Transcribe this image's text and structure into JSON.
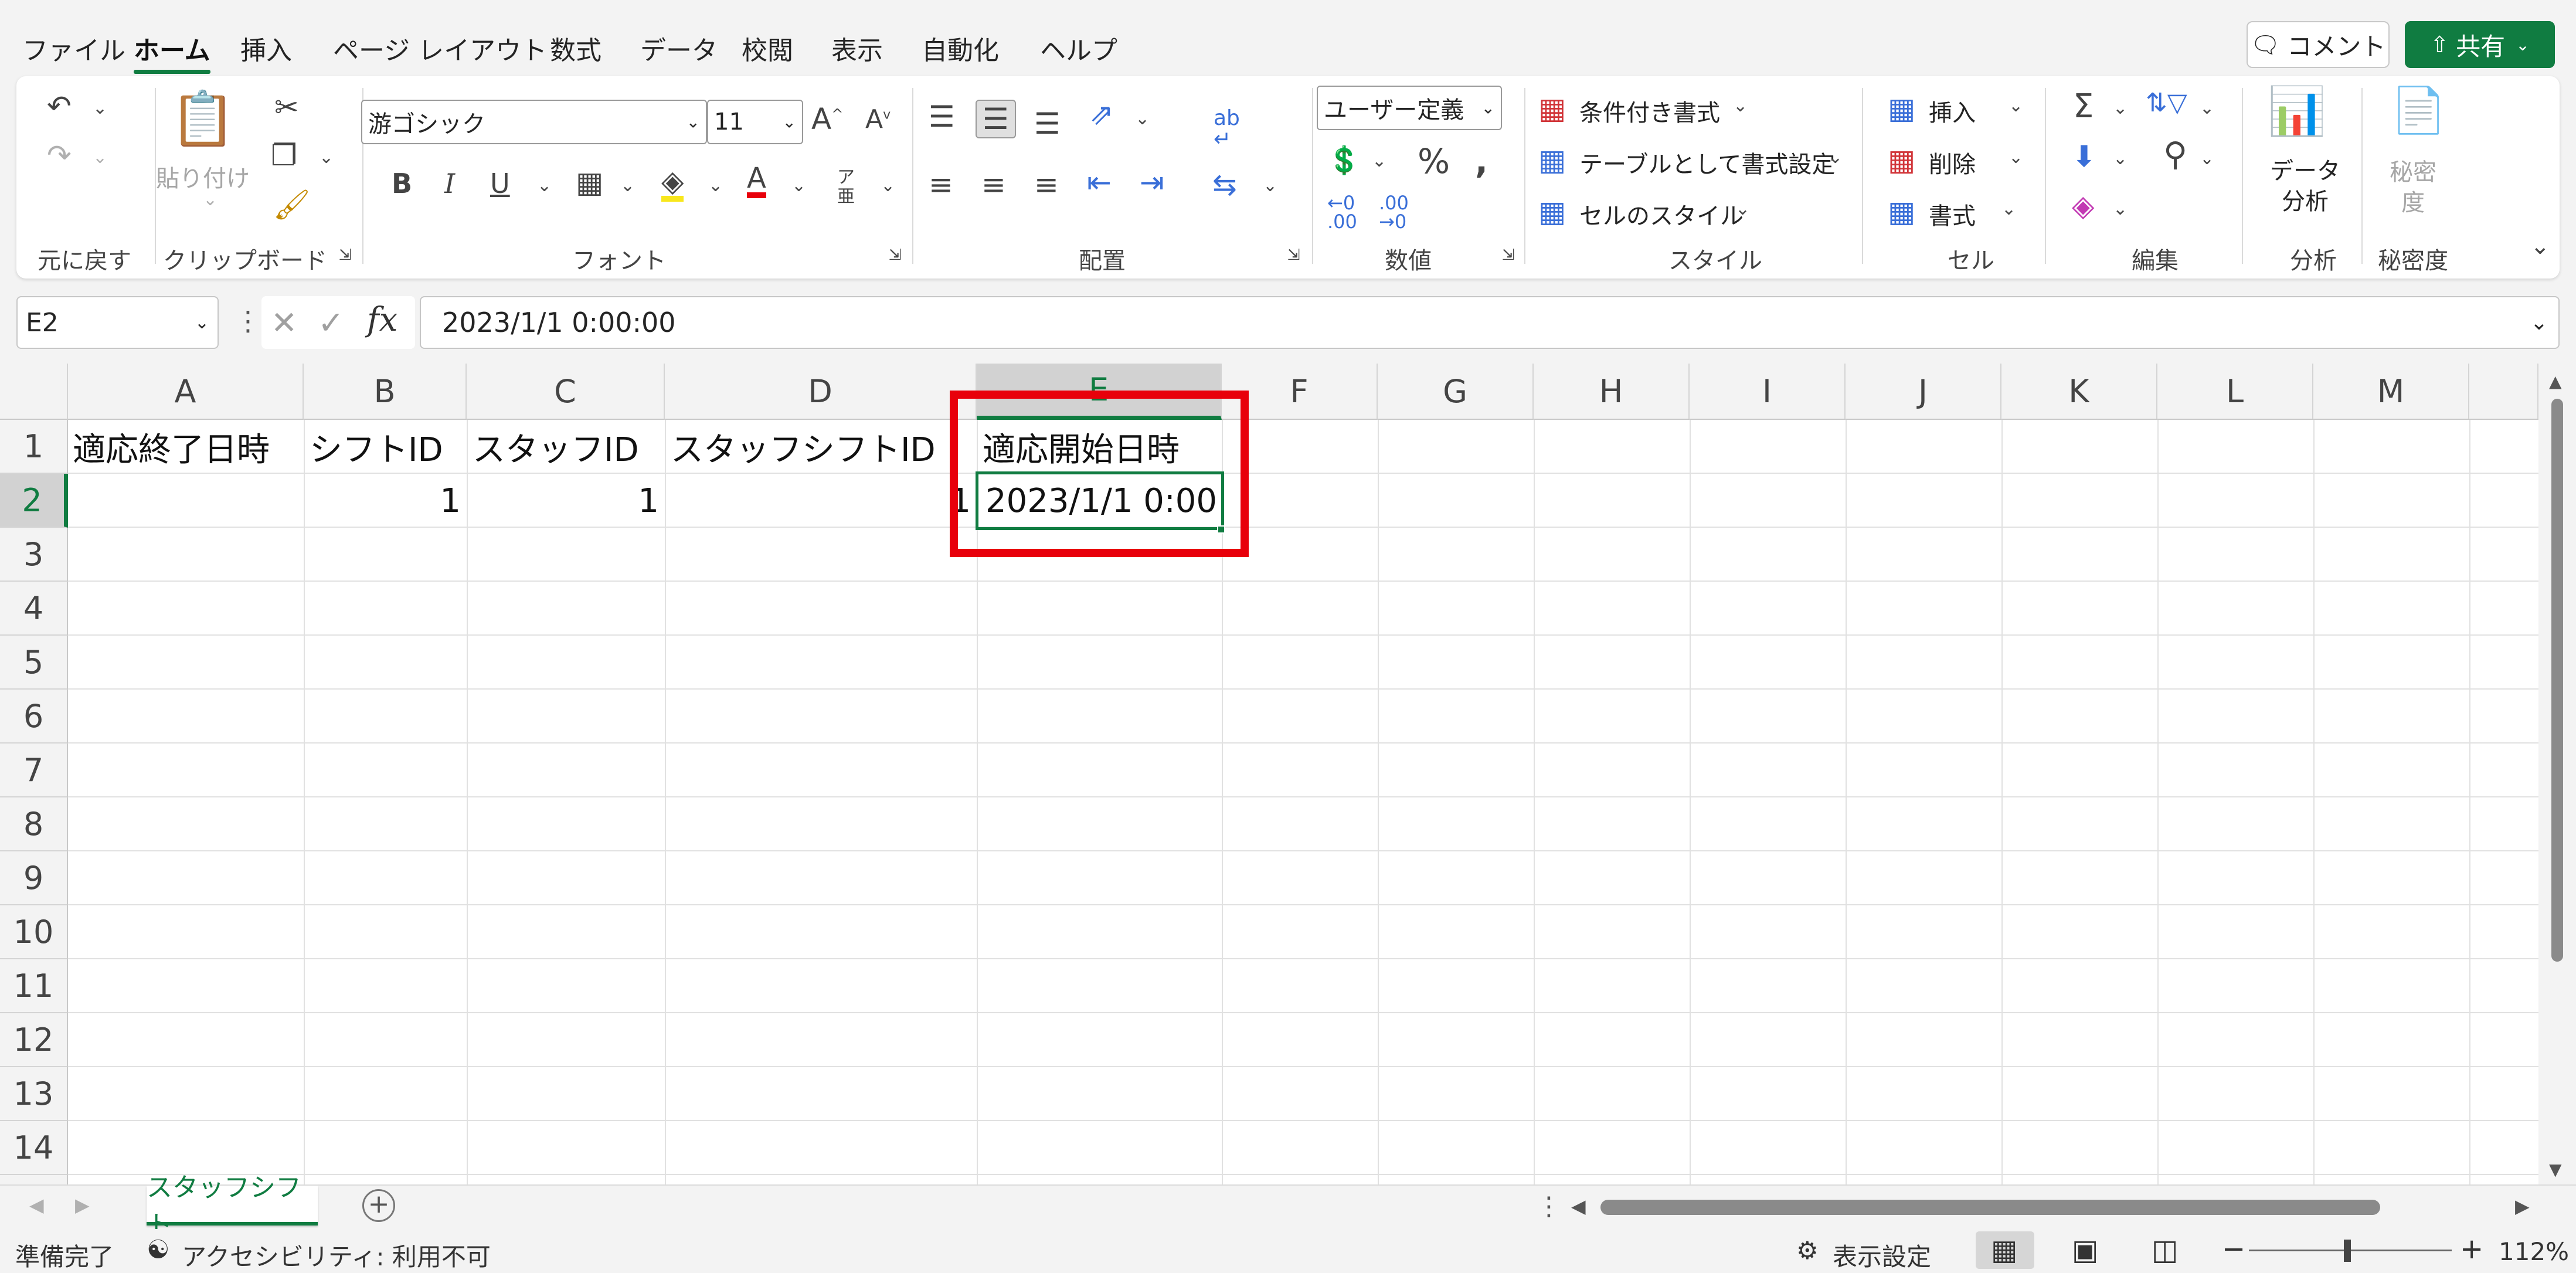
{
  "menu": {
    "tabs": [
      "ファイル",
      "ホーム",
      "挿入",
      "ページ レイアウト",
      "数式",
      "データ",
      "校閲",
      "表示",
      "自動化",
      "ヘルプ"
    ],
    "active_tab": "ホーム",
    "comment_button": "コメント",
    "share_button": "共有"
  },
  "ribbon": {
    "undo_group": "元に戻す",
    "clipboard": {
      "label": "クリップボード",
      "paste": "貼り付け"
    },
    "font": {
      "label": "フォント",
      "family": "游ゴシック",
      "size": "11"
    },
    "alignment": {
      "label": "配置"
    },
    "number": {
      "label": "数値",
      "format": "ユーザー定義"
    },
    "styles": {
      "label": "スタイル",
      "conditional": "条件付き書式",
      "as_table": "テーブルとして書式設定",
      "cell_styles": "セルのスタイル"
    },
    "cells": {
      "label": "セル",
      "insert": "挿入",
      "delete": "削除",
      "format": "書式"
    },
    "editing": {
      "label": "編集"
    },
    "analysis": {
      "label": "分析",
      "button_line1": "データ",
      "button_line2": "分析"
    },
    "sensitivity": {
      "label": "秘密度",
      "button_line1": "秘密",
      "button_line2": "度"
    }
  },
  "formula_bar": {
    "name_box": "E2",
    "formula": "2023/1/1  0:00:00"
  },
  "sheet": {
    "columns": [
      "A",
      "B",
      "C",
      "D",
      "E",
      "F",
      "G",
      "H",
      "I",
      "J",
      "K",
      "L",
      "M"
    ],
    "rows": [
      "1",
      "2",
      "3",
      "4",
      "5",
      "6",
      "7",
      "8",
      "9",
      "10",
      "11",
      "12",
      "13",
      "14"
    ],
    "header_row": [
      "適応終了日時",
      "シフトID",
      "スタッフID",
      "スタッフシフトID",
      "適応開始日時"
    ],
    "data_row": [
      "",
      "1",
      "1",
      "1",
      "2023/1/1 0:00"
    ],
    "selected_cell": "E2",
    "highlight_color": "#e8000b",
    "accent_color": "#107c41"
  },
  "sheet_tabs": {
    "active": "スタッフシフト",
    "add_symbol": "+"
  },
  "status": {
    "ready": "準備完了",
    "accessibility": "アクセシビリティ: 利用不可",
    "display_settings": "表示設定",
    "zoom": "112%"
  }
}
